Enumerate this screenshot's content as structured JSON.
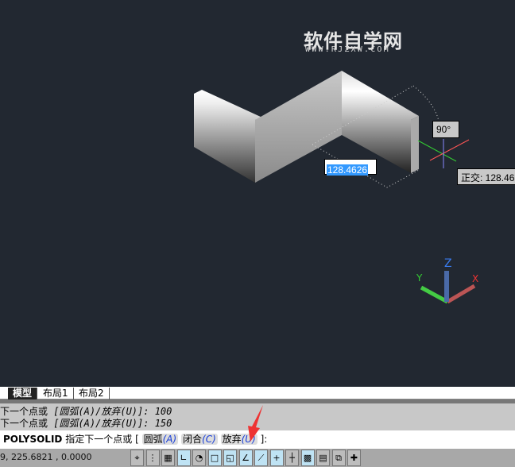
{
  "watermark": {
    "title": "软件自学网",
    "url": "WWW.RJZXW.COM"
  },
  "viewport": {
    "dynamic_input": "128.4626",
    "angle": "90°",
    "ortho_tooltip": "正交: 128.46"
  },
  "ucs": {
    "x": "X",
    "y": "Y",
    "z": "Z"
  },
  "tabs": [
    {
      "label": "模型"
    },
    {
      "label": "布局1"
    },
    {
      "label": "布局2"
    }
  ],
  "history": [
    {
      "text": "下一个点或 ",
      "opts": "[圆弧(A)/放弃(U)]: 100"
    },
    {
      "text": "下一个点或 ",
      "opts": "[圆弧(A)/放弃(U)]: 150"
    }
  ],
  "command": {
    "name": "POLYSOLID",
    "prompt": "指定下一个点或",
    "open": "[",
    "options": [
      {
        "label": "圆弧",
        "key": "(A)"
      },
      {
        "label": "闭合",
        "key": "(C)"
      },
      {
        "label": "放弃",
        "key": "(U)"
      }
    ],
    "close": "]:"
  },
  "status": {
    "coords": "9,  225.6821 , 0.0000",
    "buttons": [
      {
        "name": "infer-constraints",
        "glyph": "⌖",
        "on": false
      },
      {
        "name": "snap",
        "glyph": "⋮",
        "on": false
      },
      {
        "name": "grid",
        "glyph": "▦",
        "on": false
      },
      {
        "name": "ortho",
        "glyph": "∟",
        "on": true
      },
      {
        "name": "polar",
        "glyph": "◔",
        "on": false
      },
      {
        "name": "osnap",
        "glyph": "□",
        "on": true
      },
      {
        "name": "3d-osnap",
        "glyph": "◱",
        "on": true
      },
      {
        "name": "otrack",
        "glyph": "∠",
        "on": true
      },
      {
        "name": "ducs",
        "glyph": "⟋",
        "on": true
      },
      {
        "name": "dyn",
        "glyph": "+",
        "on": true
      },
      {
        "name": "lineweight",
        "glyph": "┼",
        "on": false
      },
      {
        "name": "transparency",
        "glyph": "▩",
        "on": true
      },
      {
        "name": "quick-properties",
        "glyph": "▤",
        "on": false
      },
      {
        "name": "selection-cycling",
        "glyph": "⧉",
        "on": false
      },
      {
        "name": "annotation-monitor",
        "glyph": "✚",
        "on": false
      }
    ]
  }
}
